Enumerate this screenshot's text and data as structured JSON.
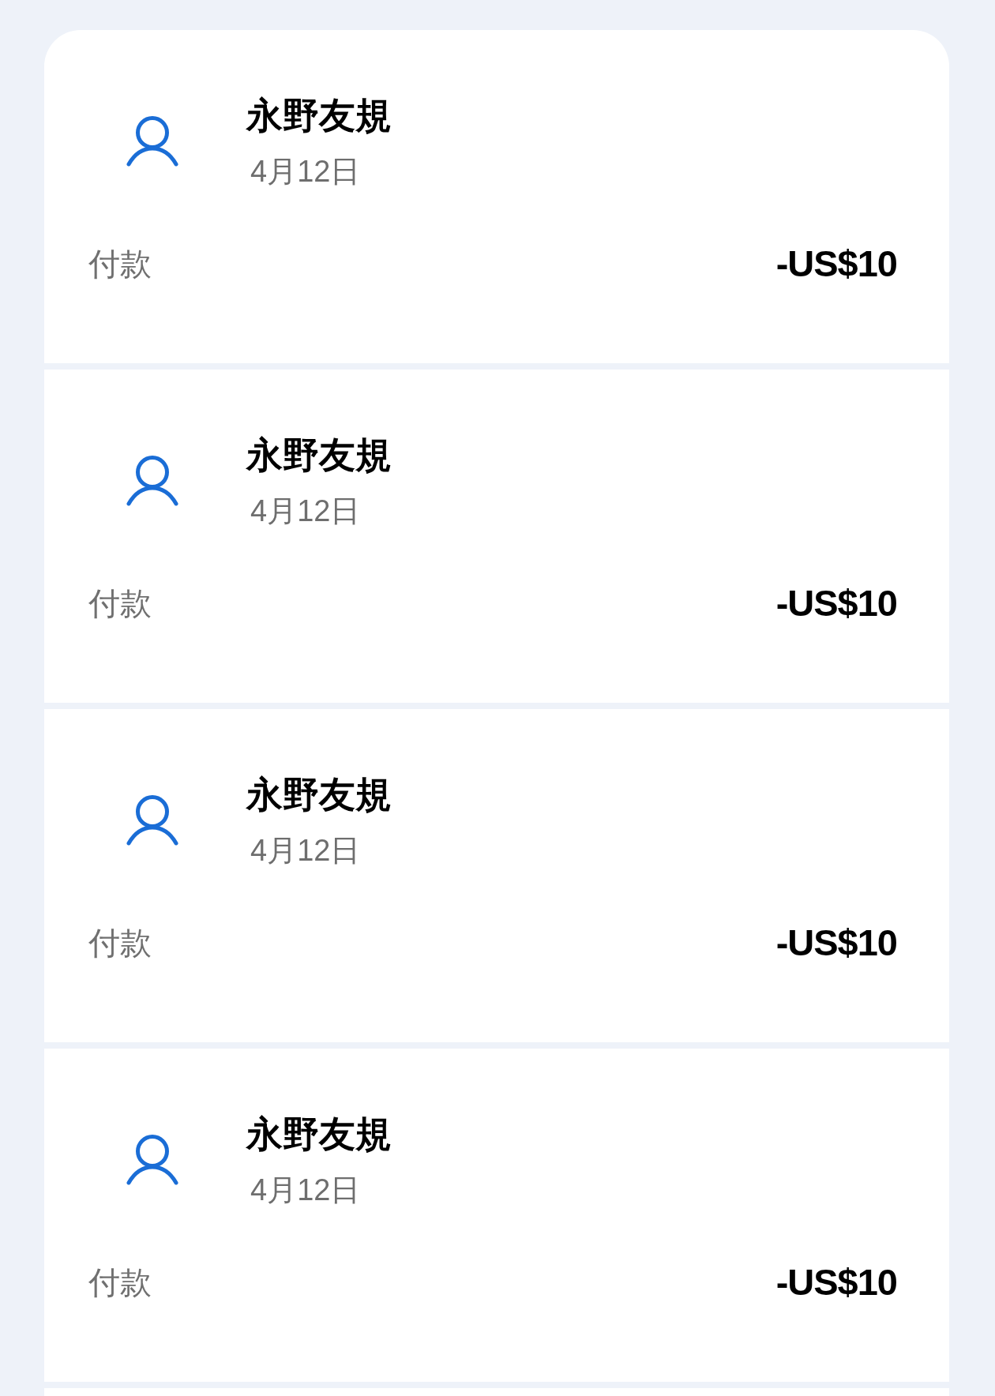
{
  "transactions": [
    {
      "payee": "永野友規",
      "date": "4月12日",
      "type": "付款",
      "amount": "-US$10"
    },
    {
      "payee": "永野友規",
      "date": "4月12日",
      "type": "付款",
      "amount": "-US$10"
    },
    {
      "payee": "永野友規",
      "date": "4月12日",
      "type": "付款",
      "amount": "-US$10"
    },
    {
      "payee": "永野友規",
      "date": "4月12日",
      "type": "付款",
      "amount": "-US$10"
    }
  ],
  "list": {
    "continues_below": true
  }
}
